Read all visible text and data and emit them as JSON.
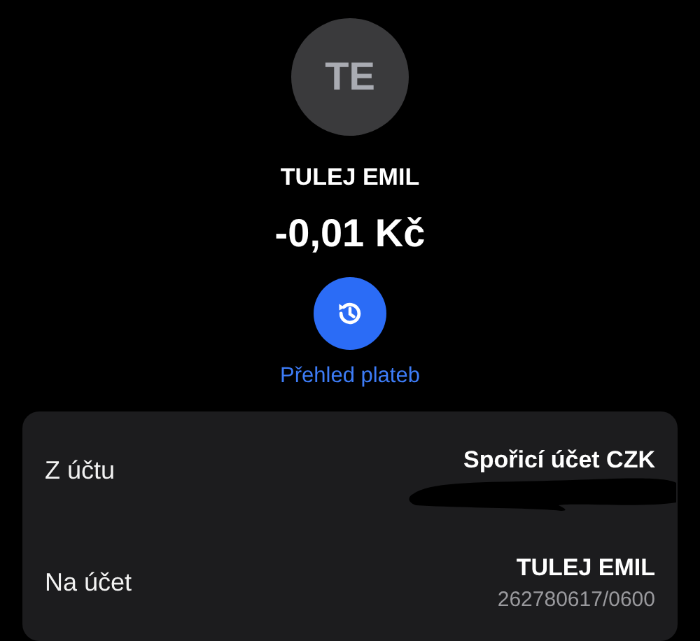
{
  "avatar": {
    "initials": "TE"
  },
  "payee": "TULEJ EMIL",
  "amount": "-0,01 Kč",
  "history_link": "Přehled plateb",
  "details": [
    {
      "label": "Z účtu",
      "value": "Spořicí účet CZK",
      "redacted": true
    },
    {
      "label": "Na účet",
      "value": "TULEJ EMIL",
      "account": "262780617/0600",
      "redacted": false
    }
  ]
}
